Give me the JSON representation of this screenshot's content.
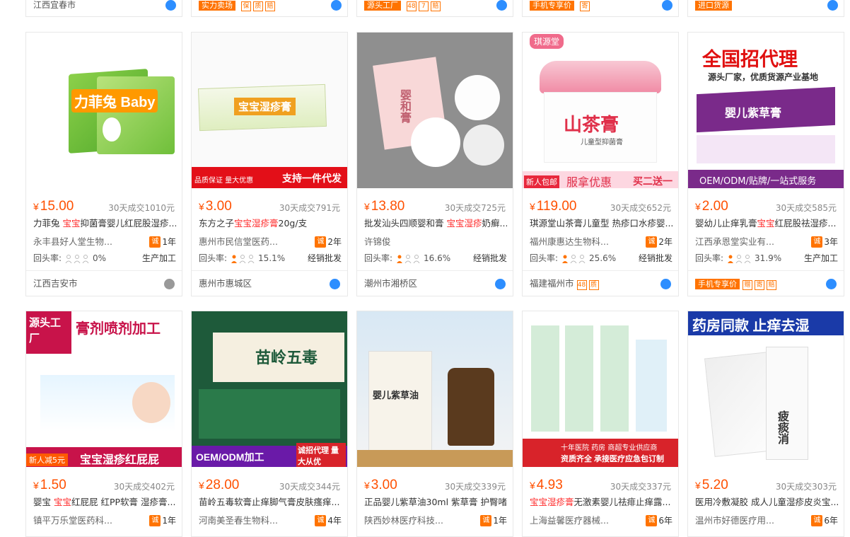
{
  "top_row": [
    {
      "location": "江西宜春市",
      "badges": []
    },
    {
      "location": "",
      "badges": [
        "实力卖场"
      ]
    },
    {
      "location": "",
      "badges": [
        "源头工厂"
      ]
    },
    {
      "location": "",
      "badges": [
        "手机专享价"
      ]
    },
    {
      "location": "",
      "badges": [
        "进口货源"
      ]
    }
  ],
  "currency": "¥",
  "products_row1": [
    {
      "price": "15.00",
      "sold": "30天成交1010元",
      "title_pre": "力菲兔 ",
      "title_hl": "宝宝",
      "title_post": "抑菌膏婴儿红屁股湿疹...",
      "seller": "永丰县好人堂生物...",
      "years": "1年",
      "rate_label": "回头率:",
      "rate": "0%",
      "biz": "生产加工",
      "location": "江西吉安市",
      "img_text": "力菲兔 Baby"
    },
    {
      "price": "3.00",
      "sold": "30天成交791元",
      "title_pre": "东方之子",
      "title_hl": "宝宝湿疹膏",
      "title_post": "20g/支",
      "seller": "惠州市民信堂医药...",
      "years": "2年",
      "rate_label": "回头率:",
      "rate": "15.1%",
      "biz": "经销批发",
      "location": "惠州市惠城区",
      "img_text": "宝宝湿疹膏",
      "banner_left": "品质保证  量大优惠",
      "banner_right": "支持一件代发"
    },
    {
      "price": "13.80",
      "sold": "30天成交725元",
      "title_pre": "批发汕头四顺婴和膏 ",
      "title_hl": "宝宝湿疹",
      "title_post": "奶癣...",
      "seller": "许锦俊",
      "years": "",
      "rate_label": "回头率:",
      "rate": "16.6%",
      "biz": "经销批发",
      "location": "潮州市湘桥区",
      "img_text": "婴和膏"
    },
    {
      "price": "119.00",
      "sold": "30天成交652元",
      "title_pre": "琪源堂山茶膏儿童型 热疹口水疹婴...",
      "title_hl": "",
      "title_post": "",
      "seller": "福州康惠达生物科...",
      "years": "2年",
      "rate_label": "回头率:",
      "rate": "25.6%",
      "biz": "经销批发",
      "location": "福建福州市",
      "img_text": "山茶膏",
      "img_sub": "儿童型抑菌膏",
      "brand": "琪源堂",
      "banner_left": "新人包邮",
      "banner_mid": "服拿优惠",
      "banner_right": "买二送一"
    },
    {
      "price": "2.00",
      "sold": "30天成交585元",
      "title_pre": "婴幼儿止痒乳膏",
      "title_hl": "宝宝",
      "title_post": "红屁股祛湿疹...",
      "seller": "江西承恩堂实业有...",
      "years": "3年",
      "rate_label": "回头率:",
      "rate": "31.9%",
      "biz": "生产加工",
      "location": "手机专享价",
      "img_text": "全国招代理",
      "img_sub": "源头厂家，优质货源产业基地",
      "img_box": "婴儿紫草膏",
      "img_foot": "OEM/ODM/贴牌/一站式服务"
    }
  ],
  "products_row2": [
    {
      "price": "1.50",
      "sold": "30天成交402元",
      "title_pre": "婴宝 ",
      "title_hl": "宝宝",
      "title_post": "红屁屁 红PP软膏 湿疹膏...",
      "seller": "镇平万乐堂医药科...",
      "years": "1年",
      "img_text": "膏剂喷剂加工",
      "img_tag": "源头工厂",
      "banner": "宝宝湿疹红屁屁",
      "corner": "新人减5元"
    },
    {
      "price": "28.00",
      "sold": "30天成交344元",
      "title_pre": "苗岭五毒软膏止痒脚气膏皮肤瘙痒...",
      "title_hl": "",
      "title_post": "",
      "seller": "河南美圣春生物科...",
      "years": "4年",
      "img_text": "苗岭五毒",
      "banner_left": "OEM/ODM加工",
      "banner_right": "诚招代理 量大从优"
    },
    {
      "price": "3.00",
      "sold": "30天成交339元",
      "title_pre": "正品婴儿紫草油30ml 紫草膏 护臀啫...",
      "title_hl": "",
      "title_post": "",
      "seller": "陕西妙林医疗科技...",
      "years": "1年",
      "img_text": "婴儿紫草油"
    },
    {
      "price": "4.93",
      "sold": "30天成交337元",
      "title_pre": "",
      "title_hl": "宝宝湿疹膏",
      "title_post": "无激素婴儿祛痱止痒露...",
      "seller": "上海益馨医疗器械...",
      "years": "6年",
      "img_text": "十年医院 药房 商超专业供应商",
      "img_sub": "资质齐全 承接医疗应急包订制"
    },
    {
      "price": "5.20",
      "sold": "30天成交303元",
      "title_pre": "医用冷敷凝胶 成人儿童湿疹皮炎宝...",
      "title_hl": "",
      "title_post": "",
      "seller": "温州市好德医疗用...",
      "years": "6年",
      "img_text": "药房同款 止痒去湿",
      "img_sub": "疲痰消"
    }
  ],
  "colors": {
    "accent": "#ff5000",
    "orange": "#ff7300",
    "link_blue": "#2d8eff"
  }
}
